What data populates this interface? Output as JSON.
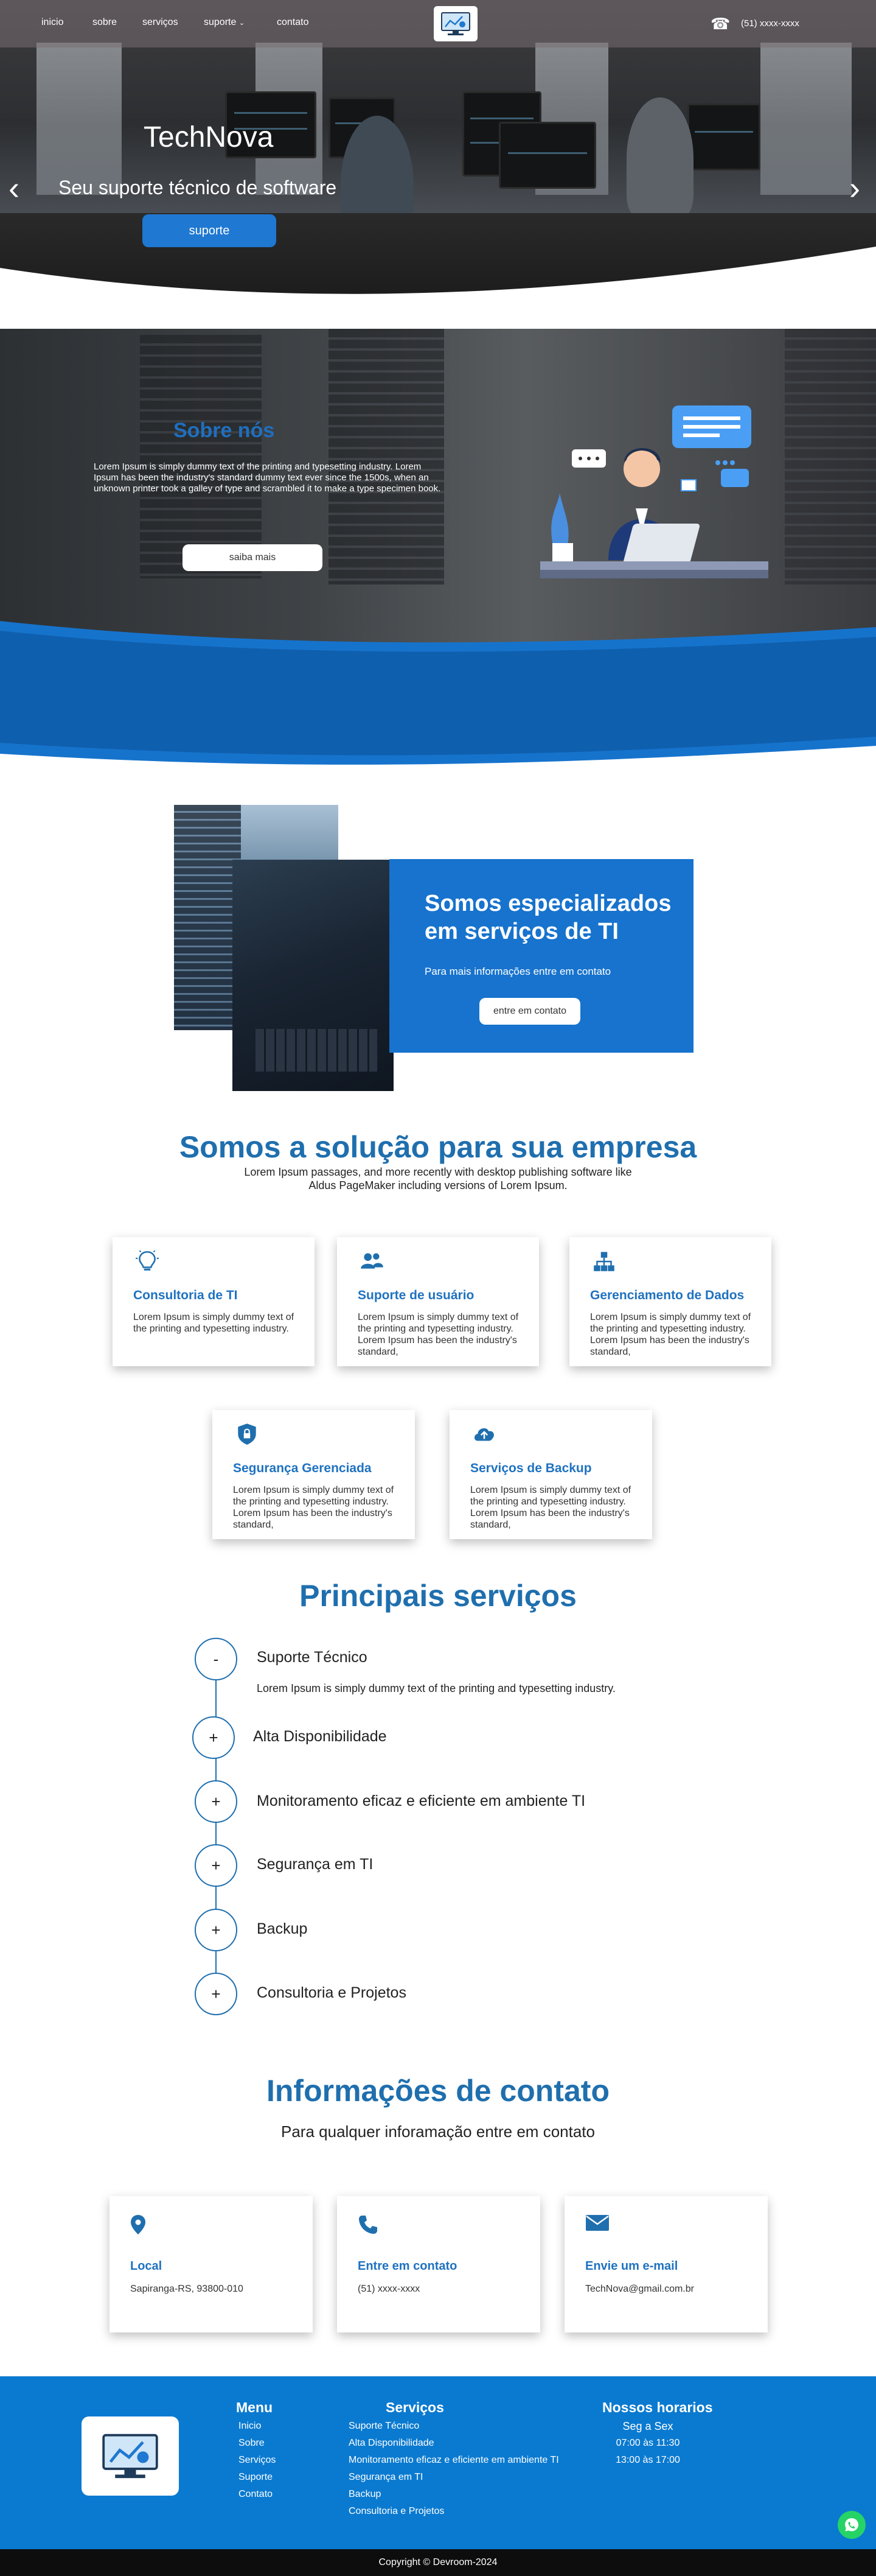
{
  "nav": {
    "links": [
      "inicio",
      "sobre",
      "serviços",
      "suporte",
      "contato"
    ],
    "phone": "(51) xxxx-xxxx"
  },
  "hero": {
    "title": "TechNova",
    "subtitle": "Seu suporte técnico de software",
    "button": "suporte"
  },
  "about": {
    "title": "Sobre nós",
    "text": "Lorem Ipsum is simply dummy text of the printing and typesetting industry. Lorem Ipsum has been the industry's standard dummy text ever since the 1500s, when an unknown printer took a galley of type and scrambled it to make a type specimen book.",
    "button": "saiba mais"
  },
  "special": {
    "title": "Somos especializados em serviços de TI",
    "info": "Para mais informações entre em contato",
    "button": "entre em contato"
  },
  "solutions": {
    "title": "Somos a solução para sua empresa",
    "text": "Lorem Ipsum passages, and more recently with desktop publishing software like Aldus PageMaker including versions of Lorem Ipsum.",
    "cards": [
      {
        "icon": "lightbulb-icon",
        "title": "Consultoria de TI",
        "text": "Lorem Ipsum is simply dummy text of the printing and typesetting industry."
      },
      {
        "icon": "users-icon",
        "title": "Suporte de usuário",
        "text": "Lorem Ipsum is simply dummy text of the printing and typesetting industry. Lorem Ipsum has been the industry's standard,"
      },
      {
        "icon": "hierarchy-icon",
        "title": "Gerenciamento de Dados",
        "text": "Lorem Ipsum is simply dummy text of the printing and typesetting industry. Lorem Ipsum has been the industry's standard,"
      },
      {
        "icon": "shield-icon",
        "title": "Segurança Gerenciada",
        "text": "Lorem Ipsum is simply dummy text of the printing and typesetting industry. Lorem Ipsum has been the industry's standard,"
      },
      {
        "icon": "cloud-upload-icon",
        "title": "Serviços de Backup",
        "text": "Lorem Ipsum is simply dummy text of the printing and typesetting industry. Lorem Ipsum has been the industry's standard,"
      }
    ]
  },
  "services": {
    "title": "Principais serviços",
    "items": [
      {
        "label": "Suporte Técnico",
        "toggle": "-",
        "expanded": true,
        "description": "Lorem Ipsum is simply dummy text of the printing and typesetting industry."
      },
      {
        "label": "Alta Disponibilidade",
        "toggle": "+"
      },
      {
        "label": "Monitoramento eficaz e eficiente em ambiente TI",
        "toggle": "+"
      },
      {
        "label": "Segurança em TI",
        "toggle": "+"
      },
      {
        "label": "Backup",
        "toggle": "+"
      },
      {
        "label": "Consultoria e Projetos",
        "toggle": "+"
      }
    ]
  },
  "contact": {
    "title": "Informações de contato",
    "subtitle": "Para qualquer inforamação entre em contato",
    "cards": [
      {
        "icon": "map-pin-icon",
        "title": "Local",
        "text": "Sapiranga-RS, 93800-010"
      },
      {
        "icon": "phone-icon",
        "title": "Entre em contato",
        "text": "(51) xxxx-xxxx"
      },
      {
        "icon": "envelope-icon",
        "title": "Envie um e-mail",
        "text": "TechNova@gmail.com.br"
      }
    ]
  },
  "footer": {
    "menu_title": "Menu",
    "menu": [
      "Inicio",
      "Sobre",
      "Serviços",
      "Suporte",
      "Contato"
    ],
    "services_title": "Serviços",
    "services": [
      "Suporte Técnico",
      "Alta Disponibilidade",
      "Monitoramento eficaz e eficiente em ambiente TI",
      "Segurança em TI",
      "Backup",
      "Consultoria e Projetos"
    ],
    "hours_title": "Nossos horarios",
    "hours": [
      "Seg a Sex",
      "07:00 às 11:30",
      "13:00 às 17:00"
    ],
    "copyright": "Copyright © Devroom-2024"
  },
  "colors": {
    "brand": "#1f6fae",
    "button": "#1f78d1",
    "footer": "#0a7ad0",
    "whatsapp": "#25d366"
  }
}
